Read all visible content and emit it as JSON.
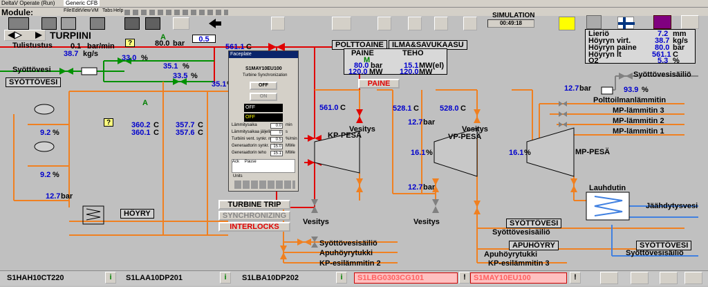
{
  "window": {
    "title1": "DeltaV Operate (Run)",
    "title2": "Generic CFB",
    "menu": [
      "File",
      "Edit",
      "View",
      "VM",
      "Tabs",
      "Help"
    ],
    "module_label": "Module:"
  },
  "header": {
    "title": "TURPIINI",
    "simulation_label": "SIMULATION",
    "simulation_time": "00:49:18",
    "setpoint": "0.5",
    "pressure_label": "A",
    "pressure_value": "80.0",
    "pressure_unit": "bar"
  },
  "tabs": {
    "polttoaine": "POLTTOAINE",
    "ilma": "ILMA&SAVUKAASU",
    "paine_button": "PAINE"
  },
  "summary_left": {
    "paine_label": "PAINE",
    "teho_label": "TEHO",
    "m_label": "M",
    "p1": "80.0",
    "p1_unit": "bar",
    "p2": "120.0",
    "p2_unit": "MW",
    "t1": "15.1",
    "t1_unit": "MW(el)",
    "t2": "120.0",
    "t2_unit": "MW"
  },
  "summary_right": {
    "rows": [
      {
        "label": "Lieriö",
        "value": "7.2",
        "unit": "mm"
      },
      {
        "label": "Höyryn virt.",
        "value": "38.7",
        "unit": "kg/s"
      },
      {
        "label": "Höyryn paine",
        "value": "80.0",
        "unit": "bar"
      },
      {
        "label": "Höyryn lt",
        "value": "561.1",
        "unit": "C"
      },
      {
        "label": "O2",
        "value": "5.3",
        "unit": "%"
      }
    ]
  },
  "left": {
    "tulistustus": "Tulistustus",
    "flow1": "0.1",
    "flow1_unit": "bar/min",
    "flow2": "38.7",
    "flow2_unit": "kg/s",
    "syottovesi": "Syöttövesi",
    "syottovesi_tag": "SYÖTTÖVESI",
    "v1": "33.0",
    "v1_unit": "%",
    "v2": "35.1",
    "v2_unit": "%",
    "v3": "33.5",
    "v3_unit": "%",
    "v4": "35.1",
    "v4_unit": "%",
    "t1": "360.2",
    "t2": "360.1",
    "t3": "357.7",
    "t4": "357.6",
    "t_unit": "C",
    "p_a": "A",
    "p_c": "C",
    "lv1": "9.2",
    "lv2": "9.2",
    "lv_unit": "%",
    "pr": "12.7",
    "pr_unit": "bar",
    "hoyry": "HÖYRY",
    "temp_top": "561.1",
    "temp_top_unit": "C"
  },
  "buttons": {
    "turbine_trip": "TURBINE TRIP",
    "synchronizing": "SYNCHRONIZING",
    "interlocks": "INTERLOCKS"
  },
  "faceplate": {
    "title": "Faceplate",
    "tag": "S1MAY10EU100",
    "desc": "Turbine Synchronization",
    "off_btn": "OFF",
    "on_btn": "ON",
    "status1": "OFF",
    "status2": "OFF",
    "rows": [
      {
        "label": "Lämmitysaika",
        "value": "0.0",
        "unit": "min"
      },
      {
        "label": "Lämmitysaikaa jäljellä",
        "value": "0",
        "unit": "s"
      },
      {
        "label": "Turbiini vent. synkr. nopeus",
        "value": "0.5",
        "unit": "%/min"
      },
      {
        "label": "Generaattorin synkr. teho",
        "value": "15.0",
        "unit": "MWe"
      },
      {
        "label": "Generaattorin teho",
        "value": "15.1",
        "unit": "MWe"
      }
    ],
    "ack": "Ack",
    "pause": "Pause",
    "units": "Units"
  },
  "turbines": {
    "kp": "KP-PESÄ",
    "vp": "VP-PESÄ",
    "mp": "MP-PESÄ",
    "kp_temp": "561.0",
    "vp_temp1": "528.1",
    "vp_temp2": "528.0",
    "temp_unit": "C",
    "vp_p1": "12.7",
    "vp_p2": "12.7",
    "p_unit": "bar",
    "vp_pct": "16.1",
    "mp_pct": "16.1",
    "pct_unit": "%",
    "vesitys": "Vesitys"
  },
  "right": {
    "syottovesisailio": "Syöttövesisäiliö",
    "pr": "12.7",
    "pr_unit": "bar",
    "pct": "93.9",
    "pct_unit": "%",
    "polttoilma": "Polttoilmanlämmitin",
    "mp3": "MP-lämmitin 3",
    "mp2": "MP-lämmitin 2",
    "mp1": "MP-lämmitin 1",
    "lauhdutin": "Lauhdutin",
    "jaahdytysvesi": "Jäähdytysvesi",
    "syottovesi_tag": "SYÖTTÖVESI",
    "apuhoyry_tag": "APUHÖYRY",
    "apuhoyrytukki": "Apuhöyrytukki",
    "kp3": "KP-esilämmitin 3",
    "kp2": "KP-esilämmitin 2"
  },
  "statusbar": {
    "c1": "S1HAH10CT220",
    "c2": "S1LAA10DP201",
    "c3": "S1LBA10DP202",
    "c4": "S1LBG0303CG101",
    "c5": "S1MAY10EU100",
    "i": "i",
    "excl": "!"
  }
}
